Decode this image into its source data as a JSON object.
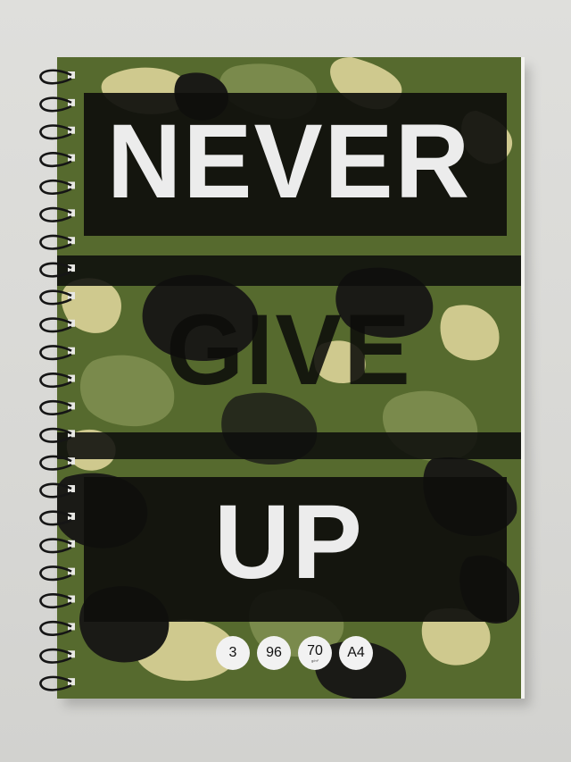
{
  "cover": {
    "line1": "NEVER",
    "line2": "GIVE",
    "line3": "UP"
  },
  "badges": [
    {
      "value": "3",
      "sub": ""
    },
    {
      "value": "96",
      "sub": ""
    },
    {
      "value": "70",
      "sub": "g/m²"
    },
    {
      "value": "A4",
      "sub": ""
    }
  ],
  "colors": {
    "background": "#dcdcd9",
    "camo_dark": "#1a1a16",
    "camo_olive": "#566a2e",
    "camo_sand": "#cfc98e",
    "band": "#0e0e0c",
    "text_light": "#ececec"
  },
  "icons": {
    "binding": "spiral-binding-icon"
  }
}
